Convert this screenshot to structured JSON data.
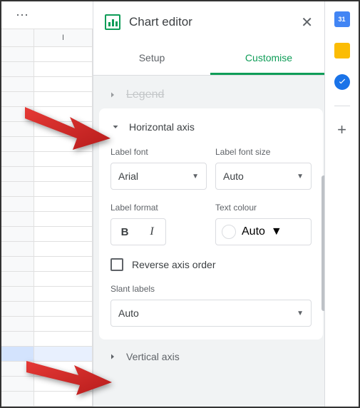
{
  "spreadsheet": {
    "col_label": "I"
  },
  "panel": {
    "title": "Chart editor",
    "tabs": {
      "setup": "Setup",
      "customise": "Customise"
    },
    "legend_section": "Legend",
    "horizontal_axis": {
      "title": "Horizontal axis",
      "label_font": {
        "label": "Label font",
        "value": "Arial"
      },
      "label_font_size": {
        "label": "Label font size",
        "value": "Auto"
      },
      "label_format": {
        "label": "Label format",
        "bold": "B",
        "italic": "I"
      },
      "text_colour": {
        "label": "Text colour",
        "value": "Auto"
      },
      "reverse": "Reverse axis order",
      "slant": {
        "label": "Slant labels",
        "value": "Auto"
      }
    },
    "vertical_axis": {
      "title": "Vertical axis"
    }
  },
  "sidebar": {
    "calendar_day": "31"
  }
}
